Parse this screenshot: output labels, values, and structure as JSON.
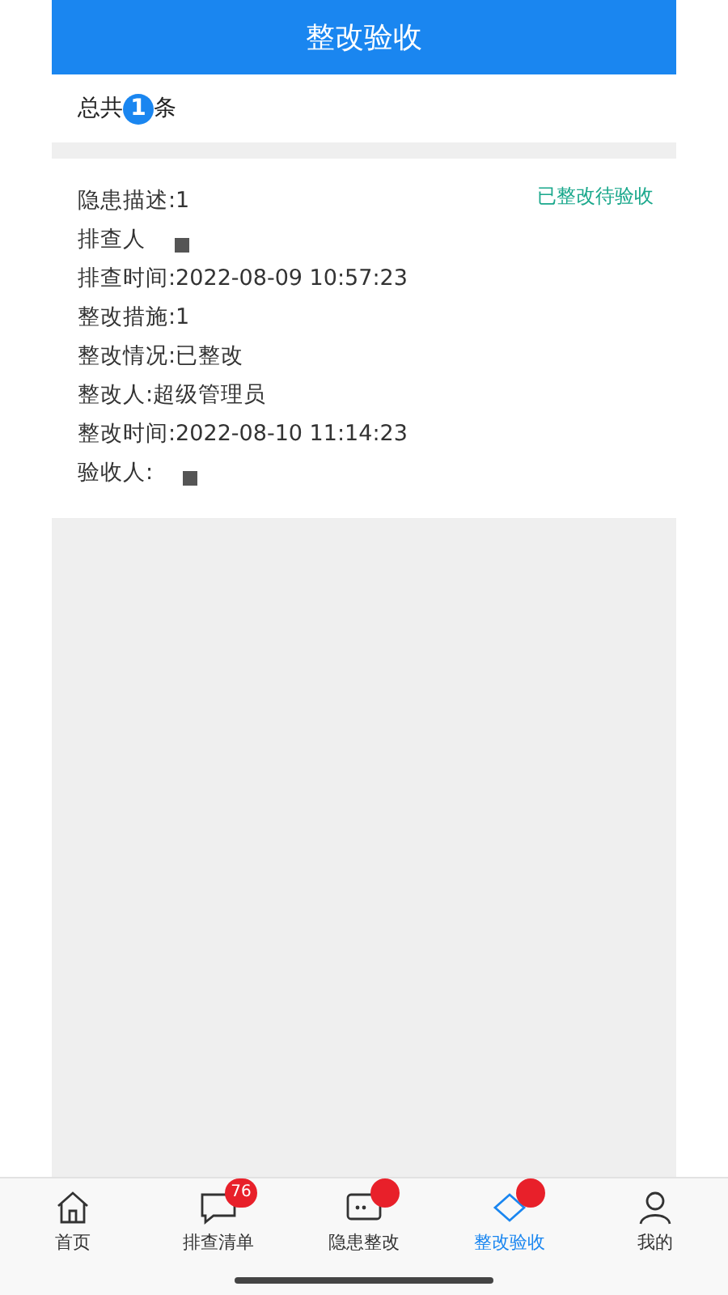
{
  "header": {
    "title": "整改验收"
  },
  "summary": {
    "prefix": "总共",
    "count": "1",
    "suffix": "条"
  },
  "records": [
    {
      "status": "已整改待验收",
      "fields": [
        {
          "text": "隐患描述:1",
          "redacted": false
        },
        {
          "text": "排查人",
          "redacted": true
        },
        {
          "text": "排查时间:2022-08-09 10:57:23",
          "redacted": false
        },
        {
          "text": "整改措施:1",
          "redacted": false
        },
        {
          "text": "整改情况:已整改",
          "redacted": false
        },
        {
          "text": "整改人:超级管理员",
          "redacted": false
        },
        {
          "text": "整改时间:2022-08-10 11:14:23",
          "redacted": false
        },
        {
          "text": "验收人:",
          "redacted": true
        }
      ]
    }
  ],
  "tab_bar": [
    {
      "kind": "home",
      "label": "首页",
      "selected": false
    },
    {
      "kind": "chat",
      "label": "排查清单",
      "selected": false,
      "badge": "76"
    },
    {
      "kind": "fix",
      "label": "隐患整改",
      "selected": false,
      "dot": true
    },
    {
      "kind": "check",
      "label": "整改验收",
      "selected": true,
      "dot": true
    },
    {
      "kind": "user",
      "label": "我的",
      "selected": false
    }
  ]
}
